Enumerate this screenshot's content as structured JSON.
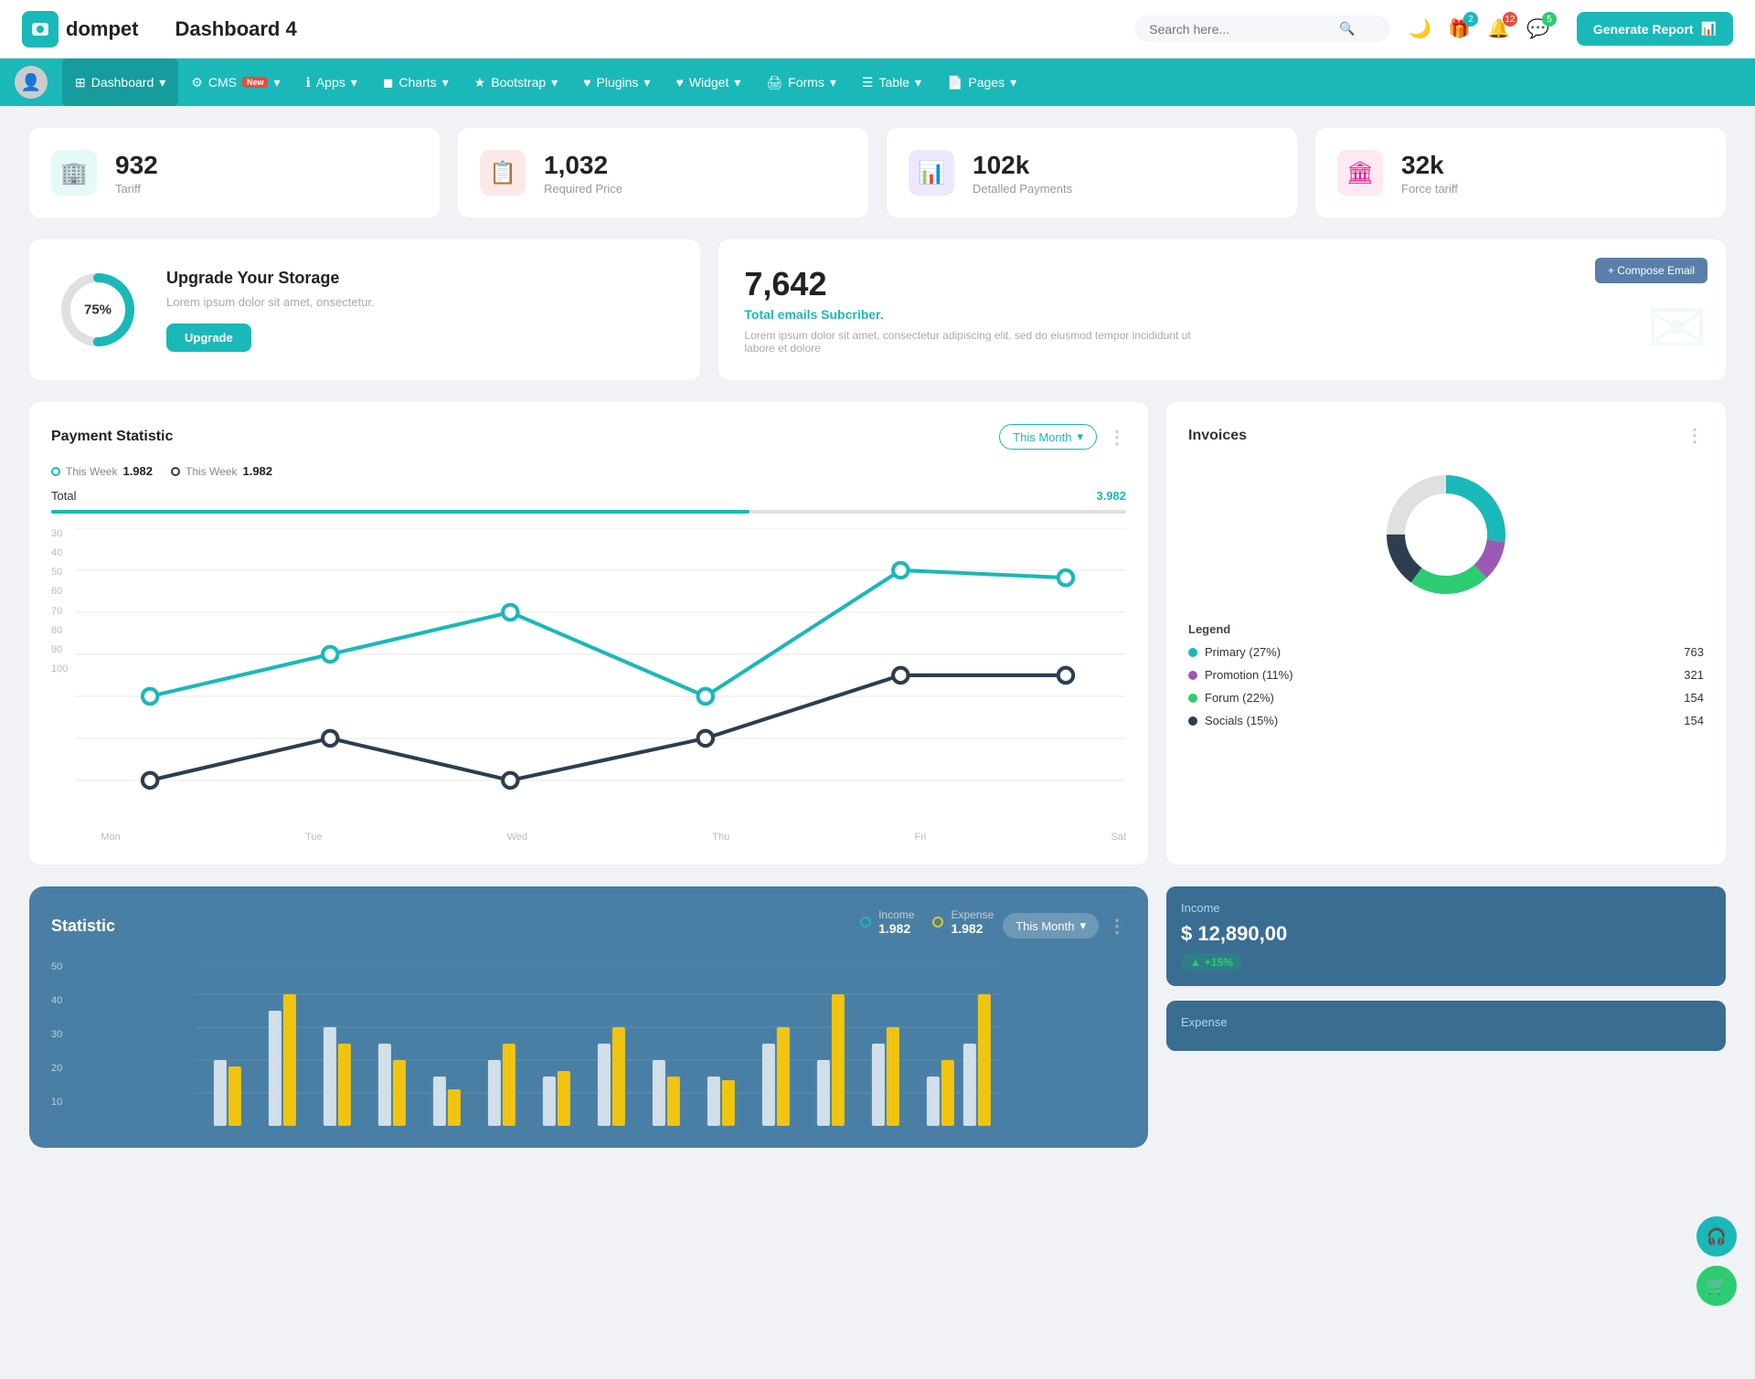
{
  "app": {
    "logo_text": "dompet",
    "title": "Dashboard 4",
    "search_placeholder": "Search here...",
    "generate_btn": "Generate Report"
  },
  "topbar_icons": {
    "moon": "🌙",
    "gift_count": "2",
    "bell_count": "12",
    "chat_count": "5"
  },
  "navbar": {
    "items": [
      {
        "label": "Dashboard",
        "icon": "⊞",
        "active": true,
        "has_dropdown": true
      },
      {
        "label": "CMS",
        "icon": "⚙",
        "active": false,
        "has_dropdown": true,
        "badge": "New"
      },
      {
        "label": "Apps",
        "icon": "ℹ",
        "active": false,
        "has_dropdown": true
      },
      {
        "label": "Charts",
        "icon": "⬛",
        "active": false,
        "has_dropdown": true
      },
      {
        "label": "Bootstrap",
        "icon": "★",
        "active": false,
        "has_dropdown": true
      },
      {
        "label": "Plugins",
        "icon": "♥",
        "active": false,
        "has_dropdown": true
      },
      {
        "label": "Widget",
        "icon": "♥",
        "active": false,
        "has_dropdown": true
      },
      {
        "label": "Forms",
        "icon": "🖨",
        "active": false,
        "has_dropdown": true
      },
      {
        "label": "Table",
        "icon": "☰",
        "active": false,
        "has_dropdown": true
      },
      {
        "label": "Pages",
        "icon": "📄",
        "active": false,
        "has_dropdown": true
      }
    ]
  },
  "stat_cards": [
    {
      "value": "932",
      "label": "Tariff",
      "icon": "🏢",
      "icon_class": "teal"
    },
    {
      "value": "1,032",
      "label": "Required Price",
      "icon": "📋",
      "icon_class": "red"
    },
    {
      "value": "102k",
      "label": "Detalled Payments",
      "icon": "📊",
      "icon_class": "purple"
    },
    {
      "value": "32k",
      "label": "Force tariff",
      "icon": "🏛",
      "icon_class": "pink"
    }
  ],
  "storage": {
    "percent": "75%",
    "title": "Upgrade Your Storage",
    "desc": "Lorem ipsum dolor sit amet, onsectetur.",
    "btn": "Upgrade"
  },
  "email": {
    "count": "7,642",
    "subtitle": "Total emails Subcriber.",
    "desc": "Lorem ipsum dolor sit amet, consectetur adipiscing elit, sed do eiusmod tempor incididunt ut labore et dolore",
    "compose_btn": "+ Compose Email"
  },
  "payment": {
    "title": "Payment Statistic",
    "legend1_label": "This Week",
    "legend1_val": "1.982",
    "legend2_label": "This Week",
    "legend2_val": "1.982",
    "month_btn": "This Month",
    "total_label": "Total",
    "total_val": "3.982",
    "y_labels": [
      "100",
      "90",
      "80",
      "70",
      "60",
      "50",
      "40",
      "30"
    ],
    "x_labels": [
      "Mon",
      "Tue",
      "Wed",
      "Thu",
      "Fri",
      "Sat"
    ]
  },
  "invoices": {
    "title": "Invoices",
    "legend": [
      {
        "label": "Primary (27%)",
        "color": "#1ab8b8",
        "value": "763"
      },
      {
        "label": "Promotion (11%)",
        "color": "#9b59b6",
        "value": "321"
      },
      {
        "label": "Forum (22%)",
        "color": "#2ecc71",
        "value": "154"
      },
      {
        "label": "Socials (15%)",
        "color": "#2c3e50",
        "value": "154"
      }
    ]
  },
  "statistic": {
    "title": "Statistic",
    "month_btn": "This Month",
    "income_label": "Income",
    "income_val": "1.982",
    "expense_label": "Expense",
    "expense_val": "1.982",
    "y_labels": [
      "50",
      "40",
      "30",
      "20",
      "10"
    ],
    "income_box": {
      "label": "Income",
      "amount": "$ 12,890,00",
      "change": "+15%"
    },
    "expense_box_label": "Expense"
  },
  "month_select_label": "Month"
}
